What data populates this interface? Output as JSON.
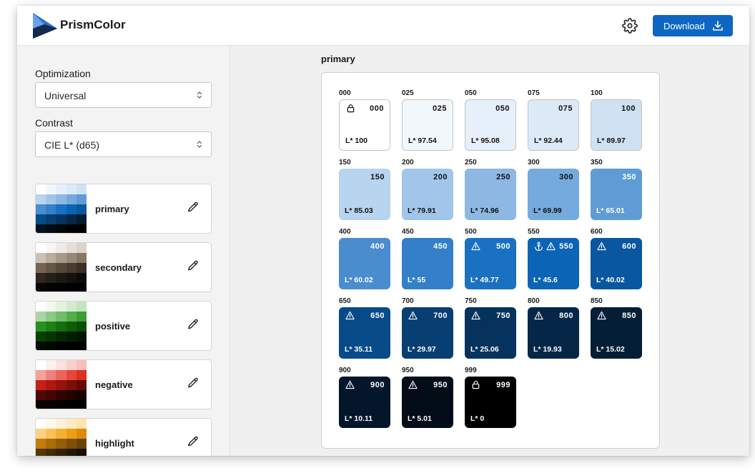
{
  "app": {
    "name": "PrismColor"
  },
  "header": {
    "download_label": "Download",
    "icons": {
      "settings": "gear-icon",
      "download": "download-icon"
    }
  },
  "sidebar": {
    "optimization": {
      "label": "Optimization",
      "value": "Universal"
    },
    "contrast": {
      "label": "Contrast",
      "value": "CIE L* (d65)"
    },
    "palettes": [
      {
        "name": "primary",
        "colors": [
          "#ffffff",
          "#f2f7fb",
          "#e6f0fa",
          "#dceaf7",
          "#cfe2f4",
          "#b8d4ee",
          "#a2c6e9",
          "#8cb8e3",
          "#75aadc",
          "#5f9bd5",
          "#4a8dcf",
          "#3380c9",
          "#1a71c2",
          "#0b64b6",
          "#09579f",
          "#084b89",
          "#073f73",
          "#06335d",
          "#052747",
          "#041b32",
          "#031220",
          "#020b14",
          "#01060b",
          "#000000",
          "#000000"
        ]
      },
      {
        "name": "secondary",
        "colors": [
          "#ffffff",
          "#f7f5f3",
          "#efeae5",
          "#e5dfd8",
          "#dcd4cc",
          "#cbc1b6",
          "#b9ada0",
          "#a89a8b",
          "#978877",
          "#867664",
          "#756553",
          "#655545",
          "#564839",
          "#483b2f",
          "#3b3026",
          "#30271f",
          "#252019",
          "#1c1813",
          "#14110e",
          "#0d0b09",
          "#080706",
          "#040403",
          "#020202",
          "#000000",
          "#000000"
        ]
      },
      {
        "name": "positive",
        "colors": [
          "#ffffff",
          "#f1f8f0",
          "#e2f1e0",
          "#d3ead0",
          "#c4e3c0",
          "#a9d6a3",
          "#8dc986",
          "#71bb69",
          "#56ad4d",
          "#3b9f32",
          "#2a8f22",
          "#1d7f16",
          "#136f0d",
          "#0c5f07",
          "#084f04",
          "#064203",
          "#053503",
          "#042902",
          "#031e02",
          "#021401",
          "#010d01",
          "#010701",
          "#000300",
          "#000000",
          "#000000"
        ]
      },
      {
        "name": "negative",
        "colors": [
          "#ffffff",
          "#fdf0ef",
          "#fbe1df",
          "#f9d0cd",
          "#f7bfbb",
          "#f3a19b",
          "#ef837b",
          "#ea655b",
          "#e5473c",
          "#d9301f",
          "#c42217",
          "#ad1911",
          "#95130c",
          "#7d0e08",
          "#660a06",
          "#520705",
          "#400504",
          "#300403",
          "#220302",
          "#160201",
          "#0d0101",
          "#070101",
          "#030000",
          "#000000",
          "#000000"
        ]
      },
      {
        "name": "highlight",
        "colors": [
          "#ffffff",
          "#fff8ec",
          "#fff1d8",
          "#feeac3",
          "#fde3ae",
          "#fbd285",
          "#f8c15c",
          "#f3b033",
          "#eb9f14",
          "#d98d0c",
          "#c27d0a",
          "#ab6d08",
          "#945e07",
          "#7e5006",
          "#694305",
          "#563704",
          "#442c03",
          "#342103",
          "#251802",
          "#181001",
          "#0e0901",
          "#060401",
          "#020100",
          "#000000",
          "#000000"
        ]
      }
    ]
  },
  "main": {
    "title": "primary",
    "swatches": [
      {
        "step": "000",
        "lstar": "L* 100",
        "bg": "#ffffff",
        "fg": "#111111",
        "icons": [
          "lock-icon"
        ]
      },
      {
        "step": "025",
        "lstar": "L* 97.54",
        "bg": "#f2f7fb",
        "fg": "#111111",
        "icons": []
      },
      {
        "step": "050",
        "lstar": "L* 95.08",
        "bg": "#e6f0fa",
        "fg": "#111111",
        "icons": []
      },
      {
        "step": "075",
        "lstar": "L* 92.44",
        "bg": "#dceaf7",
        "fg": "#111111",
        "icons": []
      },
      {
        "step": "100",
        "lstar": "L* 89.97",
        "bg": "#cfe2f4",
        "fg": "#111111",
        "icons": []
      },
      {
        "step": "150",
        "lstar": "L* 85.03",
        "bg": "#b8d4ee",
        "fg": "#111111",
        "icons": []
      },
      {
        "step": "200",
        "lstar": "L* 79.91",
        "bg": "#a2c6e9",
        "fg": "#111111",
        "icons": []
      },
      {
        "step": "250",
        "lstar": "L* 74.96",
        "bg": "#8cb8e3",
        "fg": "#111111",
        "icons": []
      },
      {
        "step": "300",
        "lstar": "L* 69.99",
        "bg": "#75aadc",
        "fg": "#111111",
        "icons": []
      },
      {
        "step": "350",
        "lstar": "L* 65.01",
        "bg": "#5f9bd5",
        "fg": "#ffffff",
        "icons": []
      },
      {
        "step": "400",
        "lstar": "L* 60.02",
        "bg": "#4a8dcf",
        "fg": "#ffffff",
        "icons": []
      },
      {
        "step": "450",
        "lstar": "L* 55",
        "bg": "#3380c9",
        "fg": "#ffffff",
        "icons": []
      },
      {
        "step": "500",
        "lstar": "L* 49.77",
        "bg": "#1a71c2",
        "fg": "#ffffff",
        "icons": [
          "warning-icon"
        ]
      },
      {
        "step": "550",
        "lstar": "L* 45.6",
        "bg": "#0b64b6",
        "fg": "#ffffff",
        "icons": [
          "anchor-icon",
          "warning-icon"
        ]
      },
      {
        "step": "600",
        "lstar": "L* 40.02",
        "bg": "#09579f",
        "fg": "#ffffff",
        "icons": [
          "warning-icon"
        ]
      },
      {
        "step": "650",
        "lstar": "L* 35.11",
        "bg": "#084b89",
        "fg": "#ffffff",
        "icons": [
          "warning-icon"
        ]
      },
      {
        "step": "700",
        "lstar": "L* 29.97",
        "bg": "#073f73",
        "fg": "#ffffff",
        "icons": [
          "warning-icon"
        ]
      },
      {
        "step": "750",
        "lstar": "L* 25.06",
        "bg": "#06335d",
        "fg": "#ffffff",
        "icons": [
          "warning-icon"
        ]
      },
      {
        "step": "800",
        "lstar": "L* 19.93",
        "bg": "#052747",
        "fg": "#ffffff",
        "icons": [
          "warning-icon"
        ]
      },
      {
        "step": "850",
        "lstar": "L* 15.02",
        "bg": "#041e36",
        "fg": "#ffffff",
        "icons": [
          "warning-icon"
        ]
      },
      {
        "step": "900",
        "lstar": "L* 10.11",
        "bg": "#03162a",
        "fg": "#ffffff",
        "icons": [
          "warning-icon"
        ]
      },
      {
        "step": "950",
        "lstar": "L* 5.01",
        "bg": "#020d18",
        "fg": "#ffffff",
        "icons": [
          "warning-icon"
        ]
      },
      {
        "step": "999",
        "lstar": "L* 0",
        "bg": "#000000",
        "fg": "#ffffff",
        "icons": [
          "lock-icon"
        ]
      }
    ]
  },
  "colors": {
    "accent": "#0d66c2"
  }
}
